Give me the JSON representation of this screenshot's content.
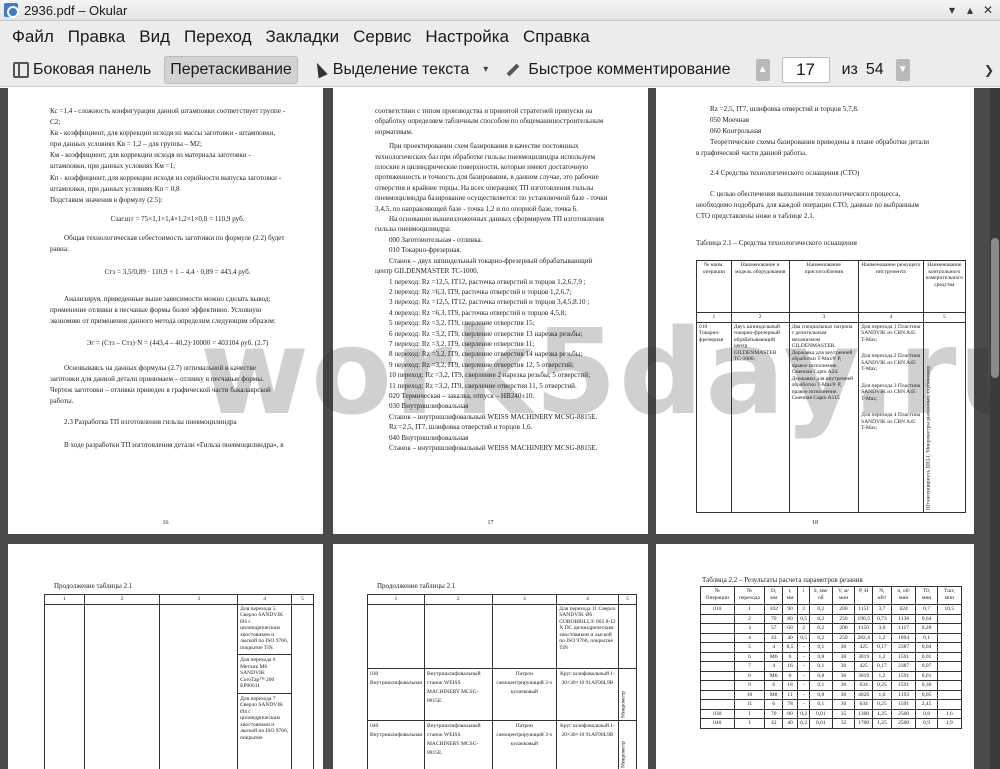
{
  "window": {
    "title": "2936.pdf – Okular"
  },
  "menu": [
    "Файл",
    "Правка",
    "Вид",
    "Переход",
    "Закладки",
    "Сервис",
    "Настройка",
    "Справка"
  ],
  "toolbar": {
    "sidebar": "Боковая панель",
    "drag": "Перетаскивание",
    "select_text": "Выделение текста",
    "quick_comment": "Быстрое комментирование",
    "page_current": "17",
    "page_of": "из",
    "page_total": "54"
  },
  "watermark": "work5day.ru",
  "page1": {
    "lines": [
      "Кс =1,4 - сложность конфигурации данной штамповки соответствует группе -",
      "С2;",
      "Кв - коэффициент, для коррекции исходя из массы заготовки - штамповки,",
      "при данных условиях Кв = 1,2 – для группы – М2;",
      "Км - коэффициент, для коррекции исходя из материала заготовки -",
      "штамповки, при данных условиях Км =1;",
      "Кп - коэффициент, для коррекции исходя из серийности выпуска заготовки -",
      "штамповки, при данных условиях Кп = 0,8",
      "Подставим значения в формулу (2.5):",
      "Сзаг.шт = 75×1,1×1,4×1,2×1×0,8 = 110,9 руб.",
      "Общая технологическая себестоимость заготовки по формуле (2.2) будет",
      "равна:",
      "Стз = 3,5/0,89 · 110,9 + 1 – 4,4 · 0,89 = 443,4 руб.",
      "Анализируя, приведенные выше зависимости можно сделать вывод:",
      "применение отливки в песчаные формы более эффективно. Условную",
      "экономию от применения данного метода определим следующим образом:",
      "Эг = (Стз – Стз)·N = (443,4 – 40,2)·10000 = 403104 руб.   (2.7)",
      "Основываясь на данных формулы (2.7) оптимальной в качестве",
      "заготовки для данной детали принимаем – отливку в песчаные формы.",
      "Чертеж заготовки – отливки приведен в графической части бакалаврской",
      "работы.",
      "2.3  Разработка ТП изготовления гильзы пневмоцилиндра",
      "В ходе разработки ТП изготовления детали «Гильза пневмоцилиндра», в"
    ],
    "page_number": "16"
  },
  "page2": {
    "lines": [
      "соответствии с типом производства и принятой стратегией припуски на",
      "обработку определяем табличным способом по общемашиностроительным",
      "нормативам.",
      "При    проектировании схем базирования в качестве постоянных",
      "технологических баз при обработке гильзы пневмоцилиндра используем",
      "плоские и цилиндрические поверхности, которые имеют достаточную",
      "протяженность и точность для базирования, в данном случае, это рабочие",
      "отверстия и крайние торцы. На всех операциях ТП изготовления гильзы",
      "пневмоцилиндра базирование осуществляется: по установочной базе - точки",
      "3,4,5, по направляющей базе - точка 1,2 и по опорной базе, точка 6.",
      "На основании вышеизложенных данных сформируем ТП изготовления",
      "гильзы пневмоцилиндра:",
      "000 Заготовительная - отливка.",
      "010 Токарно-фрезерная.",
      "Станок – двух шпиндельный токарно-фрезерный обрабатывающий",
      "центр GILDENMASTER TC-1000.",
      "1 переход: Rz =12,5, IT12, расточка отверстий  и торцов 1,2,6,7,9 ;",
      "2 переход: Rz =6,3, IT9, расточка отверстий  и торцов 1,2,6,7;",
      "3 переход: Rz =12,5, IT12, расточка отверстий  и торцов 3,4,5,8.10 ;",
      "4 переход: Rz =6,3, IT9, расточка отверстий  и торцов 4,5,8;",
      "5 переход: Rz =3,2, IT9, сверление отверстия 15;",
      "6 переход: Rz =3,2, IT9, сверление отверстия 13 нарезка резьбы;",
      "7 переход: Rz =3,2, IT9, сверление отверстия 11;",
      "8 переход: Rz =3,2, IT9, сверление отверстия 14 нарезка резьбы;",
      "9 переход: Rz =3,2, IT9, сверление отверстия 12, 5 отверстий;",
      "10 переход: Rz =3,2, IT9, сверление 2 нарезка резьбы, 5 отверстий;",
      "11 переход: Rz =3,2, IT9, сверление отверстия 11, 5 отверстий.",
      "020 Термическая – закалка, отпуск – HB240±10.",
      "030 Внутришлифовальная",
      "Станок – внутришлифовальный WEISS MACHINERY MCSG-8815E.",
      "Rz =2,5, IT7, шлифовка отверстий  и торцов 1,6.",
      "040 Внутришлифовальная",
      "Станок – внутришлифовальный WEISS MACHINERY MCSG-8815E."
    ],
    "page_number": "17"
  },
  "page3": {
    "lines": [
      "Rz =2,5, IT7, шлифовка отверстий  и торцов 5,7,8.",
      "050 Моечная",
      "060 Контрольная",
      "Теоретические схемы базирования приведены в плане обработки детали",
      "в графической части данной работы.",
      "2.4  Средства технологического оснащения (СТО)",
      "С целью обеспечения выполнения технологического процесса,",
      "необходимо подобрать для каждой операции СТО, данные по выбранным",
      "СТО  представлены ниже в таблице 2.1.",
      "Таблица 2.1 – Средства технологического оснащения"
    ],
    "table_headers": [
      "№ наим. операции",
      "Наименование и модель оборудования",
      "Наименование приспособления",
      "Наименование режущего инструмента",
      "Наименование контрольного измерительного средства"
    ],
    "table_nums": [
      "1",
      "2",
      "3",
      "4",
      "5"
    ],
    "row": {
      "op": "010 Токарно-фрезерная",
      "equip": "Двух шпиндельный токарно-фрезерный обрабатывающий центр GILDENMASTER TC-1000.",
      "fixture": "Два специальных патрона с делительным механизмом GILDENMASTER. Державка для внутренней обработки T-Max® P, правое исполнение. Сменная Capto A24. Державки для внутренней обработки T-Max® P, правое исполнение. Сменная Capto A115",
      "tool1": "Для перехода 1 Пластина SANDVIK из CBN A45 T-Max;",
      "tool2": "Для перехода 2 Пластина SANDVIK из CBN A45 T-Max;",
      "tool3": "Для перехода 3 Пластина SANDVIK из CBN A45 T-Max;",
      "tool4": "Для перехода 4 Пластина SANDVIK из CBN A45 T-Max;",
      "meas": "Штангенциркуль ШЦ-I, Микрометры рычажные, глубиномер"
    },
    "page_number": "18"
  },
  "page4": {
    "caption": "Продолжение таблицы 2.1",
    "nums": [
      "1",
      "2",
      "3",
      "4",
      "5"
    ],
    "cells": [
      "Для перехода 5 Сверло SANDVIK Ø4 с цилиндрическим хвостовиком и лыской по ISO 9766, покрытие TiN.",
      "Для перехода 6 Метчик М6 SANDVIK CoroTap™ 200 EP00611",
      "Для перехода 7 Сверло SANDVIK Ø4 с цилиндрическим хвостовиком и лыской по ISO 9766, покрытие"
    ]
  },
  "page5": {
    "caption": "Продолжение таблицы 2.1",
    "nums": [
      "1",
      "2",
      "3",
      "4",
      "5"
    ],
    "top_cell": "Для перехода 11 Сверло SANDVIK Ø6 COROBRILL® 805 8-12 X DC цилиндрическим хвостовиком и лыской по ISO 9766, покрытие TiN",
    "rows": [
      {
        "op": "030 Внутришлифовальная",
        "equip": "Внутришлифовальный станок WEISS MACHINERY MCSG-8815E.",
        "fixture": "Патрон самоцентрирующий 3-х кулачковый",
        "tool": "Круг шлифовальный 1-30×30×10 91AF90L9B",
        "meas": "Микрометр"
      },
      {
        "op": "040 Внутришлифовальная",
        "equip": "Внутришлифовальный станок WEISS MACHINERY MCSG-8815E.",
        "fixture": "Патрон самоцентрирующий 3-х кулачковый",
        "tool": "Круг шлифовальный 1-20×30×10 91AF90L9B",
        "meas": "Микрометр"
      }
    ]
  },
  "page6": {
    "caption": "Таблица 2.2 – Результаты расчета параметров резания",
    "headers": [
      "№ Операции",
      "№ перехода",
      "D, мм",
      "t, мм",
      "i",
      "S, мм/об",
      "V, м/мин",
      "P, Н",
      "N, кВт",
      "n, об/мин",
      "T0, мин",
      "Tшт, мин"
    ],
    "rows": [
      [
        "010",
        "1",
        "102",
        "90",
        "2",
        "0,2",
        "200",
        "1151",
        "3,7",
        "624",
        "0,7",
        "10,5"
      ],
      [
        "",
        "2",
        "70",
        "80",
        "0,5",
        "0,2",
        "250",
        "190,5",
        "0,73",
        "1136",
        "0,64",
        ""
      ],
      [
        "",
        "3",
        "57",
        "60",
        "2",
        "0,2",
        "200",
        "1150",
        "3,6",
        "1117",
        "0,28",
        ""
      ],
      [
        "",
        "4",
        "43",
        "40",
        "0,5",
        "0,2",
        "250",
        "282,4",
        "1,2",
        "1894",
        "0,1",
        ""
      ],
      [
        "",
        "5",
        "4",
        "8,5",
        "-",
        "0,1",
        "30",
        "425",
        "0,17",
        "2387",
        "0,04",
        ""
      ],
      [
        "",
        "6",
        "M6",
        "6",
        "-",
        "0,8",
        "30",
        "3019",
        "1,2",
        "1591",
        "0,01",
        ""
      ],
      [
        "",
        "7",
        "4",
        "16",
        "-",
        "0,1",
        "30",
        "425",
        "0,17",
        "2387",
        "0,07",
        ""
      ],
      [
        "",
        "8",
        "M6",
        "6",
        "-",
        "0,8",
        "30",
        "3019",
        "1,2",
        "1591",
        "0,01",
        ""
      ],
      [
        "",
        "9",
        "6",
        "18",
        "-",
        "0,1",
        "30",
        "634",
        "0,25",
        "1591",
        "0,36",
        ""
      ],
      [
        "",
        "10",
        "M8",
        "11",
        "-",
        "0,8",
        "30",
        "4026",
        "1,6",
        "1193",
        "0,05",
        ""
      ],
      [
        "",
        "11",
        "6",
        "78",
        "-",
        "0,1",
        "30",
        "634",
        "0,25",
        "1591",
        "2,45",
        ""
      ],
      [
        "030",
        "1",
        "70",
        "80",
        "0,2",
        "0,01",
        "35",
        "1300",
        "1,25",
        "2500",
        "0,8",
        "1,6"
      ],
      [
        "040",
        "1",
        "42",
        "40",
        "0,2",
        "0,01",
        "35",
        "1700",
        "1,25",
        "2500",
        "0,9",
        "1,9"
      ]
    ]
  }
}
